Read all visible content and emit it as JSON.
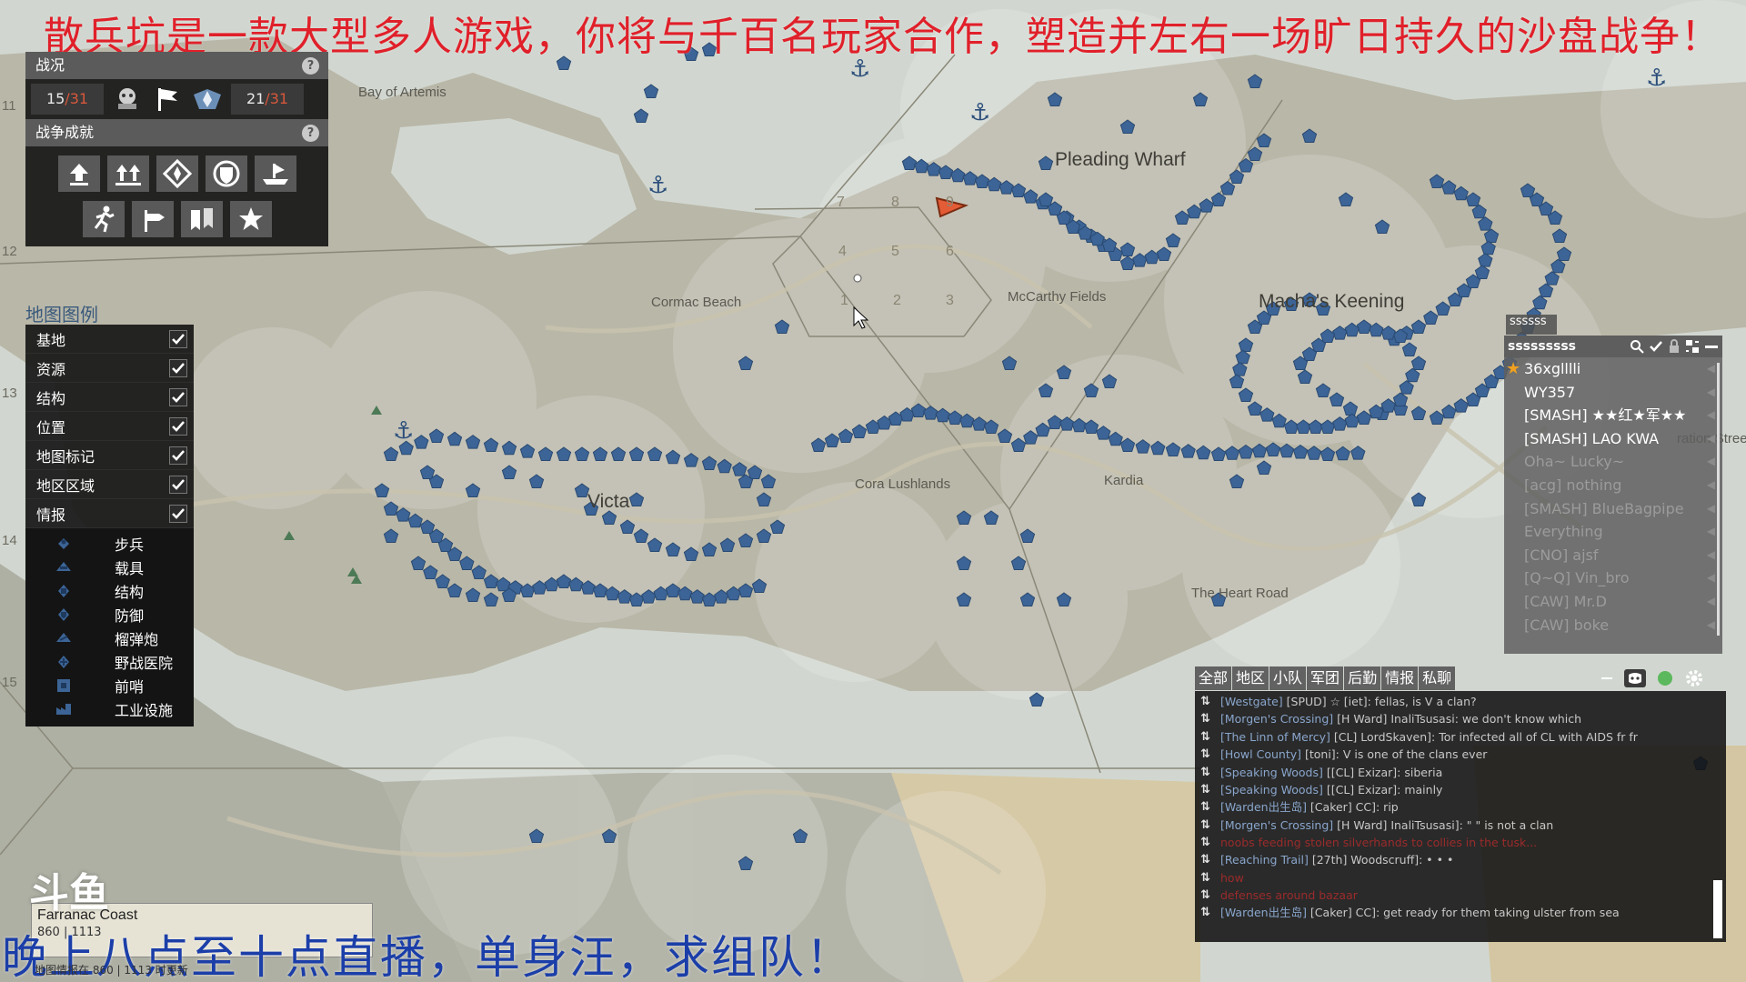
{
  "overlay": {
    "top_caption": "散兵坑是一款大型多人游戏，你将与千百名玩家合作，塑造并左右一场旷日持久的沙盘战争！",
    "bottom_caption": "晚上八点至十点直播，单身汪，求组队！",
    "watermark": "斗鱼"
  },
  "war_panel": {
    "title": "战况",
    "help": "?",
    "left_score": "15",
    "left_total": "/31",
    "right_score": "21",
    "right_total": "/31",
    "achievements_title": "战争成就",
    "achievement_icons": [
      "upgrade-icon",
      "double-upgrade-icon",
      "compass-icon",
      "shield-icon",
      "naval-icon",
      "runner-icon",
      "signpost-icon",
      "banners-icon",
      "star-icon"
    ]
  },
  "legend": {
    "title": "地图图例",
    "categories": [
      {
        "label": "基地",
        "checked": true
      },
      {
        "label": "资源",
        "checked": true
      },
      {
        "label": "结构",
        "checked": true
      },
      {
        "label": "位置",
        "checked": true
      },
      {
        "label": "地图标记",
        "checked": true
      },
      {
        "label": "地区区域",
        "checked": true
      },
      {
        "label": "情报",
        "checked": true
      }
    ],
    "intel": [
      {
        "label": "步兵",
        "icon": "infantry-icon"
      },
      {
        "label": "载具",
        "icon": "vehicle-icon"
      },
      {
        "label": "结构",
        "icon": "structure-icon"
      },
      {
        "label": "防御",
        "icon": "defense-icon"
      },
      {
        "label": "榴弹炮",
        "icon": "howitzer-icon"
      },
      {
        "label": "野战医院",
        "icon": "field-hospital-icon"
      },
      {
        "label": "前哨",
        "icon": "outpost-icon"
      },
      {
        "label": "工业设施",
        "icon": "industry-icon"
      }
    ]
  },
  "map": {
    "places": {
      "bay_of_artemis": "Bay of Artemis",
      "pleading_wharf": "Pleading Wharf",
      "cormac_beach": "Cormac Beach",
      "mccarthy_fields": "McCarthy Fields",
      "machas_keening": "Macha's Keening",
      "victa": "Victa",
      "cora_lushlands": "Cora Lushlands",
      "kardia": "Kardia",
      "the_heart_road": "The Heart Road",
      "ration_street": "ration Stree"
    },
    "hex_numbers": [
      "7",
      "8",
      "9",
      "4",
      "5",
      "6",
      "1",
      "2",
      "3"
    ],
    "grid_numbers": [
      "11",
      "12",
      "13",
      "14",
      "15"
    ],
    "colors": {
      "friendly": "#3c6496",
      "water": "#d1d7d0",
      "land": "#b9b7a8",
      "marker": "#e35c36"
    }
  },
  "player_list": {
    "tab": "ssssss",
    "header": "sssssssss",
    "players": [
      {
        "name": "36xglllli",
        "star": true,
        "dim": false
      },
      {
        "name": "WY357",
        "star": false,
        "dim": false
      },
      {
        "name": "[SMASH] ★★红★军★★",
        "star": false,
        "dim": false
      },
      {
        "name": "[SMASH] LAO KWA",
        "star": false,
        "dim": false
      },
      {
        "name": "Oha~ Lucky~",
        "star": false,
        "dim": true
      },
      {
        "name": "[acg] nothing",
        "star": false,
        "dim": true
      },
      {
        "name": "[SMASH] BlueBagpipe",
        "star": false,
        "dim": true
      },
      {
        "name": "Everything",
        "star": false,
        "dim": true
      },
      {
        "name": "[CNO] ajsf",
        "star": false,
        "dim": true
      },
      {
        "name": "[Q~Q] Vin_bro",
        "star": false,
        "dim": true
      },
      {
        "name": "[CAW] Mr.D",
        "star": false,
        "dim": true
      },
      {
        "name": "[CAW] boke",
        "star": false,
        "dim": true
      }
    ]
  },
  "chat": {
    "tabs": [
      "全部",
      "地区",
      "小队",
      "军团",
      "后勤",
      "情报",
      "私聊"
    ],
    "messages": [
      {
        "loc": "[Westgate]",
        "text": " [SPUD] ☆ [iet]: fellas, is V a clan?",
        "red": false
      },
      {
        "loc": "[Morgen's Crossing]",
        "text": " [H Ward] InaliTsusasi: we don't know which",
        "red": false
      },
      {
        "loc": "[The Linn of Mercy]",
        "text": " [CL] LordSkaven]: Tor infected all of CL with AIDS fr fr",
        "red": false
      },
      {
        "loc": "[Howl County]",
        "text": " [toni]: V is one of the clans ever",
        "red": false
      },
      {
        "loc": "[Speaking Woods]",
        "text": " [[CL] Exizar]: siberia",
        "red": false
      },
      {
        "loc": "[Speaking Woods]",
        "text": " [[CL] Exizar]: mainly",
        "red": false
      },
      {
        "loc": "[Warden出生岛]",
        "text": " [Caker] CC]: rip",
        "red": false
      },
      {
        "loc": "[Morgen's Crossing]",
        "text": " [H Ward] InaliTsusasi]: \"   \" is not a clan",
        "red": false
      },
      {
        "loc": "",
        "text": "noobs feeding stolen silverhands to collies in the tusk...",
        "red": true,
        "wrap": true
      },
      {
        "loc": "[Reaching Trail]",
        "text": " [27th] Woodscruff]: • • •",
        "red": false
      },
      {
        "loc": "",
        "text": "how",
        "red": true
      },
      {
        "loc": "",
        "text": "defenses around bazaar",
        "red": true
      },
      {
        "loc": "[Warden出生岛]",
        "text": " [Caker] CC]: get ready for them taking ulster from sea",
        "red": false
      }
    ]
  },
  "region": {
    "name": "Farranac Coast",
    "coords": "860 | 1113",
    "footnote": "地图情报在 860 | 1113 时更新"
  }
}
